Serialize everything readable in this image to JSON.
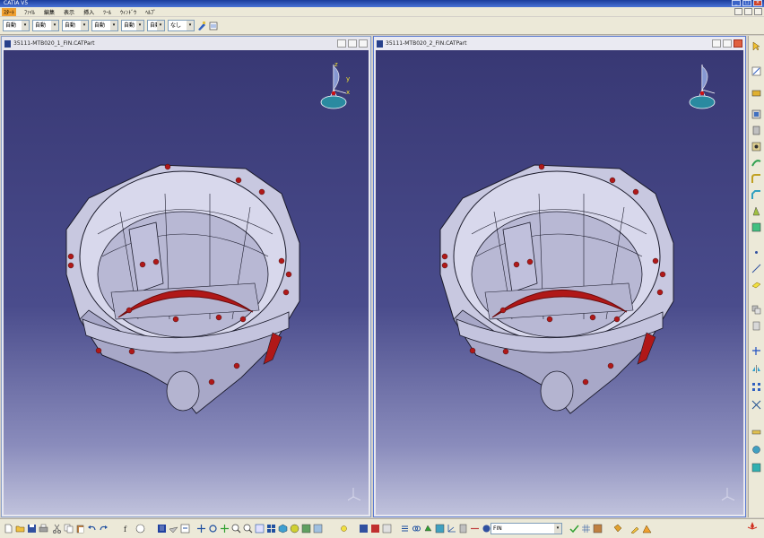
{
  "app": {
    "title": "CATIA V5"
  },
  "menu": {
    "items": [
      "ｽﾀｰﾄ",
      "ﾌｧｲﾙ",
      "編集",
      "表示",
      "挿入",
      "ﾂｰﾙ",
      "ｳｨﾝﾄﾞｳ",
      "ﾍﾙﾌﾟ"
    ]
  },
  "toolbar_top": {
    "combos": [
      {
        "label": "自動",
        "name": "color-combo"
      },
      {
        "label": "自動",
        "name": "transparency-combo"
      },
      {
        "label": "自動",
        "name": "line-thickness-combo"
      },
      {
        "label": "自動",
        "name": "line-type-combo"
      },
      {
        "label": "自動",
        "name": "point-type-combo"
      },
      {
        "label": "自動",
        "name": "rendering-style-combo"
      },
      {
        "label": "なし",
        "name": "layer-combo"
      }
    ]
  },
  "windows": {
    "left": {
      "title": "35111-MTB020_1_FIN.CATPart"
    },
    "right": {
      "title": "35111-MTB020_2_FIN.CATPart"
    }
  },
  "compass": {
    "z": "z",
    "y": "y",
    "x": "x"
  },
  "toolbar_bottom": {
    "body_combo": "FIN"
  },
  "logo": {
    "text": "CATIA"
  },
  "colors": {
    "viewport_top": "#383874",
    "viewport_bottom": "#c0c2dc",
    "part_fill": "#bcbcd8",
    "accent_red": "#b01818"
  }
}
